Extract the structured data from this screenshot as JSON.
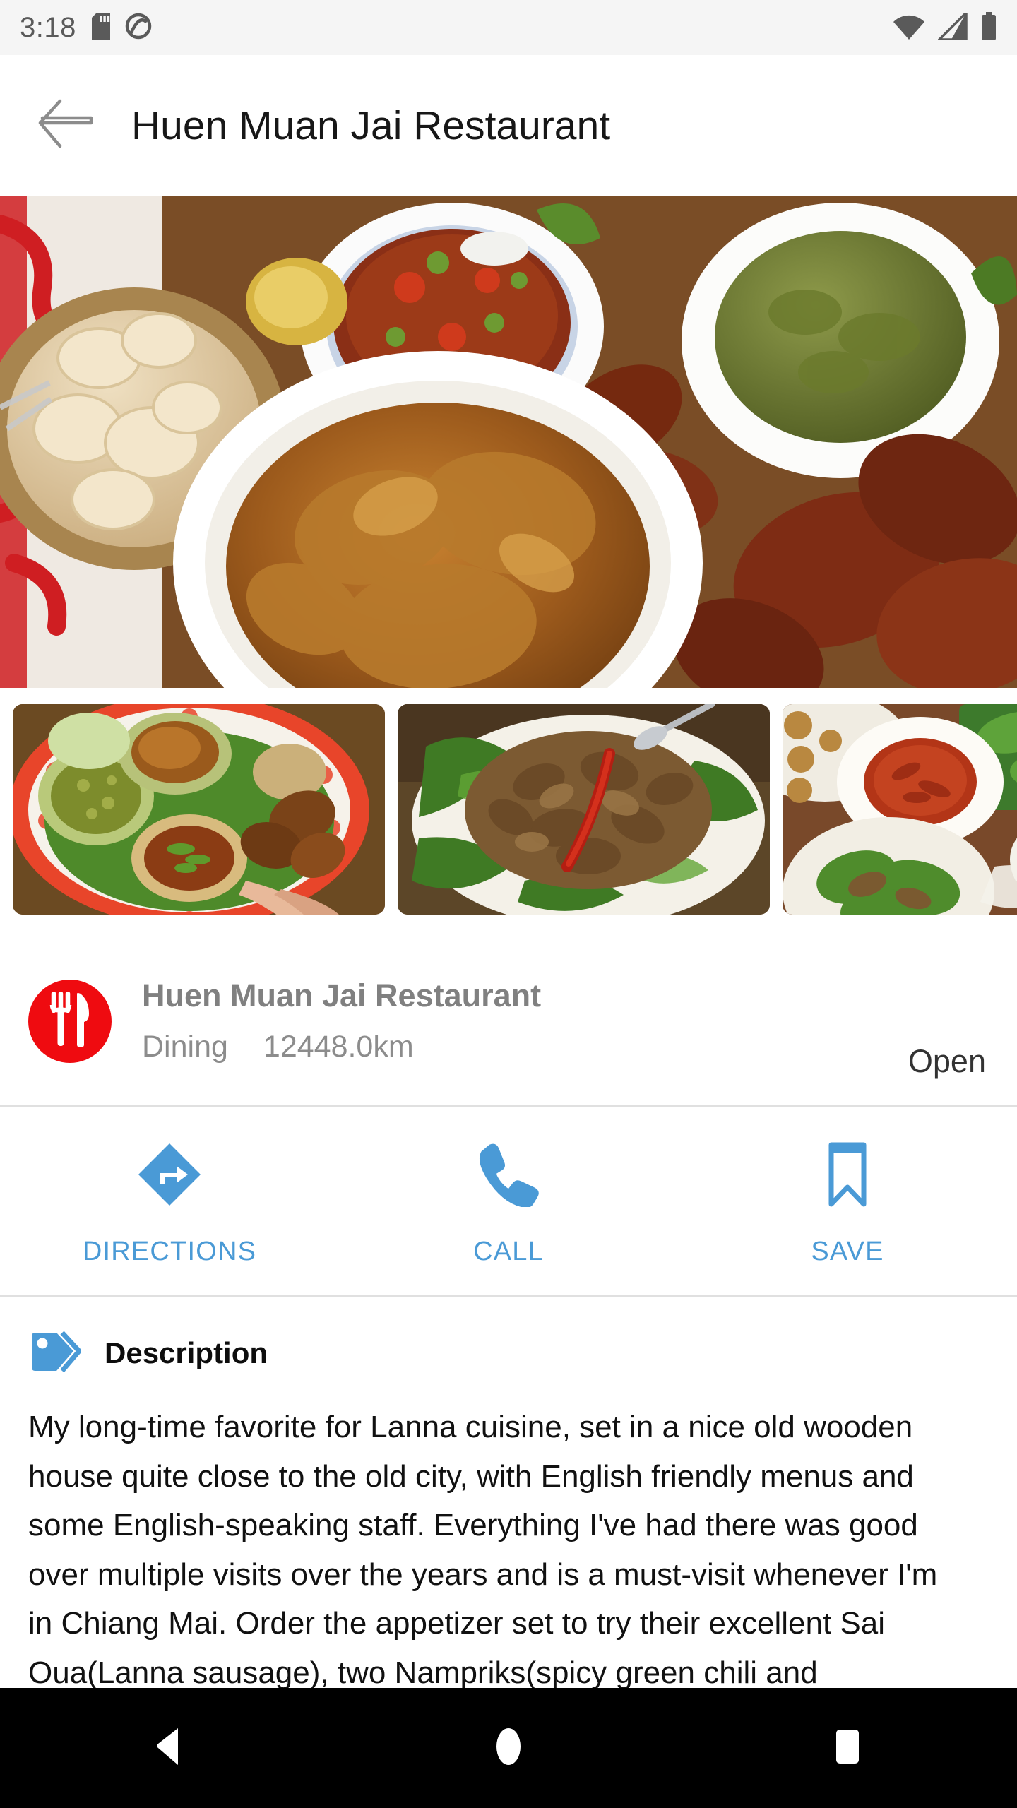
{
  "status_bar": {
    "time": "3:18",
    "icons": [
      "sd-card-icon",
      "do-not-disturb-icon",
      "wifi-icon",
      "cellular-signal-icon",
      "battery-icon"
    ]
  },
  "app_bar": {
    "back_label": "back-arrow-icon",
    "title": "Huen Muan Jai Restaurant"
  },
  "gallery": {
    "hero_alt": "Assorted Lanna dishes with pork rinds, curries and dips",
    "thumbnails": [
      {
        "alt": "Platter of Lanna dishes on red patterned plate"
      },
      {
        "alt": "Stir-fried dish with dried chili on banana leaf"
      },
      {
        "alt": "Chili dip with fresh vegetables and larb"
      }
    ]
  },
  "place": {
    "name": "Huen Muan Jai Restaurant",
    "category": "Dining",
    "distance": "12448.0km",
    "status": "Open",
    "avatar_icon": "restaurant-cutlery-icon",
    "avatar_color": "#ef0b10"
  },
  "actions": [
    {
      "label": "DIRECTIONS",
      "icon": "directions-icon"
    },
    {
      "label": "CALL",
      "icon": "phone-icon"
    },
    {
      "label": "SAVE",
      "icon": "bookmark-icon"
    }
  ],
  "description": {
    "icon": "tag-icon",
    "title": "Description",
    "body": "My long-time favorite for Lanna cuisine, set in a nice old wooden house quite close to the old city, with English friendly menus and some English-speaking staff. Everything I've had there was good over multiple visits over the years and is a must-visit whenever I'm in Chiang Mai. Order the appetizer set to try their excellent Sai Oua(Lanna sausage), two Nampriks(spicy green chili and"
  },
  "nav_bar": {
    "back": "nav-back-icon",
    "home": "nav-home-icon",
    "recents": "nav-recents-icon"
  },
  "colors": {
    "accent_blue": "#4a9ad6",
    "brand_red": "#ef0b10",
    "status_bar_bg": "#f5f5f5",
    "divider": "#e0e0e0"
  }
}
